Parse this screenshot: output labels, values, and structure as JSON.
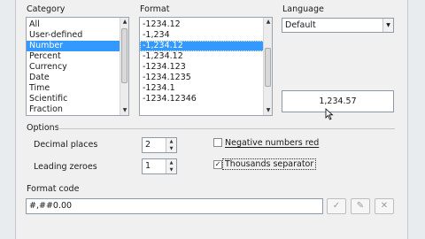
{
  "category": {
    "label": "Category",
    "items": [
      "All",
      "User-defined",
      "Number",
      "Percent",
      "Currency",
      "Date",
      "Time",
      "Scientific",
      "Fraction"
    ],
    "selected": "Number"
  },
  "format": {
    "label": "Format",
    "items": [
      "-1234.12",
      "-1,234",
      "-1,234.12",
      "-1,234.12",
      "-1234.123",
      "-1234.1235",
      "-1234.1",
      "-1234.12346"
    ],
    "selected_index": 2
  },
  "language": {
    "label": "Language",
    "value": "Default"
  },
  "preview": {
    "value": "1,234.57"
  },
  "options": {
    "label": "Options",
    "decimal_places_label": "Decimal places",
    "decimal_places_value": "2",
    "leading_zeroes_label": "Leading zeroes",
    "leading_zeroes_value": "1",
    "negative_red_label": "Negative numbers red",
    "negative_red_checked": false,
    "thousands_sep_label": "Thousands separator",
    "thousands_sep_checked": true
  },
  "format_code": {
    "label": "Format code",
    "value": "#,##0.00"
  },
  "icons": {
    "accept": "check-icon",
    "comment": "edit-comment-icon",
    "delete": "delete-icon"
  },
  "colors": {
    "selection": "#3399ff",
    "window_bg": "#f0f0f0"
  }
}
